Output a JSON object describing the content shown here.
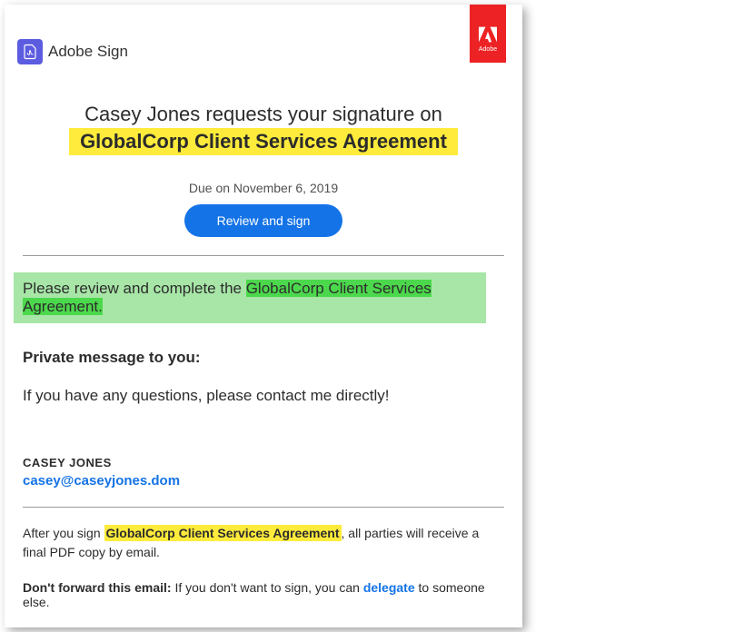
{
  "header": {
    "product_name": "Adobe Sign",
    "badge_label": "Adobe"
  },
  "request": {
    "line1": "Casey Jones requests your signature on",
    "document_title": "GlobalCorp Client Services Agreement",
    "due_text": "Due on November 6, 2019",
    "button_label": "Review and sign"
  },
  "instruction": {
    "prefix": "Please review and complete the ",
    "doc": "GlobalCorp Client Services Agreement."
  },
  "private": {
    "heading": "Private message to you:",
    "body": "If you have any questions, please contact me directly!"
  },
  "sender": {
    "name": "CASEY JONES",
    "email": "casey@caseyjones.dom"
  },
  "footer": {
    "after_prefix": "After you sign ",
    "after_doc": "GlobalCorp Client Services Agreement",
    "after_suffix": ", all parties will receive a final PDF copy by email.",
    "forward_bold": "Don't forward this email:",
    "forward_mid": " If you don't want to sign, you can ",
    "delegate": "delegate",
    "forward_end": " to someone else."
  }
}
